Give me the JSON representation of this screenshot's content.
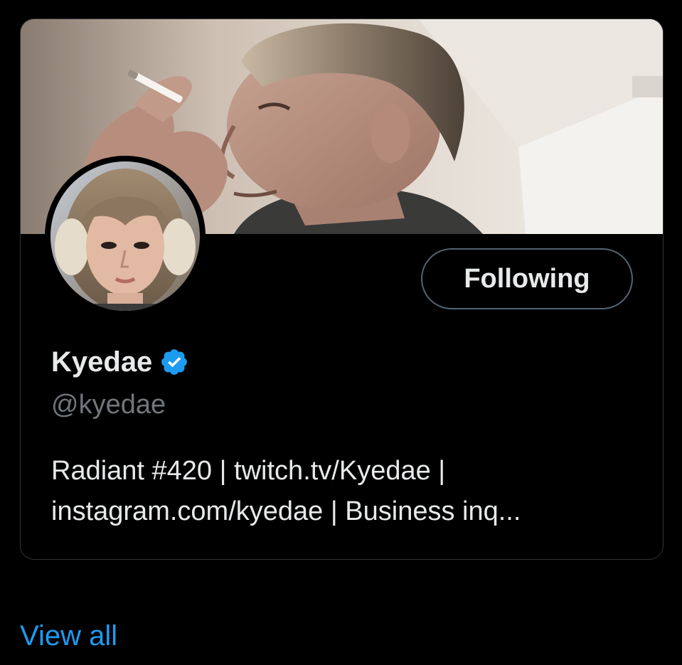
{
  "profile": {
    "display_name": "Kyedae",
    "verified_icon": "verified-badge-icon",
    "handle": "@kyedae",
    "bio_line_1": "Radiant #420 | twitch.tv/Kyedae |",
    "bio_line_2": "instagram.com/kyedae | Business inq..."
  },
  "actions": {
    "follow_label": "Following"
  },
  "footer": {
    "view_all_label": "View all"
  },
  "colors": {
    "background": "#000000",
    "text_primary": "#e7e9ea",
    "text_secondary": "#71767b",
    "accent": "#1d9bf0",
    "border": "#2f3336"
  }
}
